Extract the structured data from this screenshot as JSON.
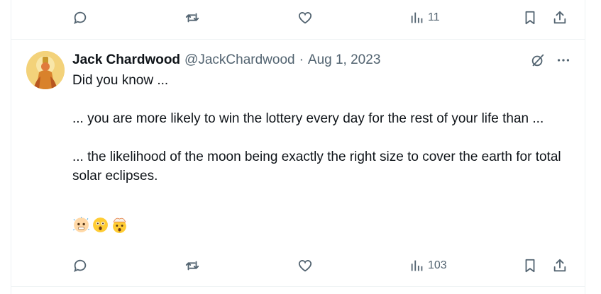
{
  "top_actions": {
    "reply_icon": "reply-icon",
    "retweet_icon": "retweet-icon",
    "like_icon": "heart-icon",
    "views_count": "11",
    "bookmark_icon": "bookmark-icon",
    "share_icon": "share-icon"
  },
  "tweet": {
    "author_name": "Jack Chardwood",
    "handle": "@JackChardwood",
    "separator": "·",
    "date": "Aug 1, 2023",
    "text_lines": [
      "Did you know ...",
      "... you are more likely to win the lottery every day for the rest of your life than ...",
      "... the likelihood of the moon being exactly the right size to cover the earth for total solar eclipses."
    ],
    "emojis": [
      "cold-face",
      "astonished-face",
      "exploding-head"
    ],
    "actions": {
      "views_count": "103"
    }
  },
  "colors": {
    "text": "#0f1419",
    "secondary": "#536471",
    "border": "#eff3f4"
  }
}
